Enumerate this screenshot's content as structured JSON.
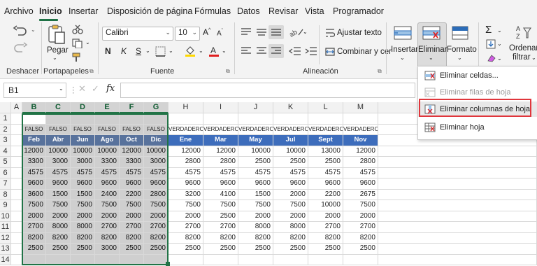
{
  "menu": {
    "tabs": [
      {
        "label": "Archivo"
      },
      {
        "label": "Inicio"
      },
      {
        "label": "Insertar"
      },
      {
        "label": "Disposición de página"
      },
      {
        "label": "Fórmulas"
      },
      {
        "label": "Datos"
      },
      {
        "label": "Revisar"
      },
      {
        "label": "Vista"
      },
      {
        "label": "Programador"
      }
    ]
  },
  "ribbon": {
    "undo_group_label": "Deshacer",
    "clipboard": {
      "paste_label": "Pegar",
      "group_label": "Portapapeles"
    },
    "font": {
      "name": "Calibri",
      "size": "10",
      "group_label": "Fuente",
      "bold": "N",
      "italic": "K",
      "underline": "S"
    },
    "alignment": {
      "wrap_label": "Ajustar texto",
      "merge_label": "Combinar y cer",
      "group_label": "Alineación"
    },
    "cells": {
      "insert_label": "Insertar",
      "delete_label": "Eliminar",
      "format_label": "Formato"
    },
    "editing": {
      "sort_label_1": "Ordenar y",
      "sort_label_2": "filtrar"
    }
  },
  "formula_bar": {
    "name_box": "B1",
    "fx": "fx",
    "value": ""
  },
  "delete_menu": {
    "items": [
      {
        "label": "Eliminar celdas...",
        "enabled": true
      },
      {
        "label": "Eliminar filas de hoja",
        "enabled": false
      },
      {
        "label": "Eliminar columnas de hoja",
        "enabled": true,
        "highlighted": true
      },
      {
        "label": "Eliminar hoja",
        "enabled": true
      }
    ]
  },
  "sheet": {
    "columns": [
      "A",
      "B",
      "C",
      "D",
      "E",
      "F",
      "G",
      "H",
      "I",
      "J",
      "K",
      "L",
      "M"
    ],
    "selected_columns": [
      "B",
      "C",
      "D",
      "E",
      "F",
      "G"
    ],
    "row_numbers": [
      "1",
      "2",
      "3",
      "4",
      "5",
      "6",
      "7",
      "8",
      "9",
      "10",
      "11",
      "12",
      "13",
      "14"
    ],
    "row2": [
      "FALSO",
      "FALSO",
      "FALSO",
      "FALSO",
      "FALSO",
      "FALSO",
      "VERDADERO",
      "VERDADERO",
      "VERDADERO",
      "VERDADERO",
      "VERDADERO",
      "VERDADERO"
    ],
    "row3": [
      "Feb",
      "Abr",
      "Jun",
      "Ago",
      "Oct",
      "Dic",
      "Ene",
      "Mar",
      "May",
      "Jul",
      "Sept",
      "Nov"
    ],
    "data": [
      [
        "12000",
        "10000",
        "10000",
        "10000",
        "12000",
        "10000",
        "12000",
        "12000",
        "10000",
        "10000",
        "13000",
        "12000"
      ],
      [
        "3300",
        "3000",
        "3000",
        "3300",
        "3300",
        "3000",
        "2800",
        "2800",
        "2500",
        "2500",
        "2500",
        "2800"
      ],
      [
        "4575",
        "4575",
        "4575",
        "4575",
        "4575",
        "4575",
        "4575",
        "4575",
        "4575",
        "4575",
        "4575",
        "4575"
      ],
      [
        "9600",
        "9600",
        "9600",
        "9600",
        "9600",
        "9600",
        "9600",
        "9600",
        "9600",
        "9600",
        "9600",
        "9600"
      ],
      [
        "3600",
        "1500",
        "1500",
        "2400",
        "2200",
        "2800",
        "3200",
        "4100",
        "1500",
        "2000",
        "2200",
        "2675"
      ],
      [
        "7500",
        "7500",
        "7500",
        "7500",
        "7500",
        "7500",
        "7500",
        "7500",
        "7500",
        "7500",
        "10000",
        "7500"
      ],
      [
        "2000",
        "2000",
        "2000",
        "2000",
        "2000",
        "2000",
        "2000",
        "2500",
        "2000",
        "2000",
        "2000",
        "2000"
      ],
      [
        "2700",
        "8000",
        "8000",
        "2700",
        "2700",
        "2700",
        "2700",
        "2700",
        "8000",
        "8000",
        "2700",
        "2700"
      ],
      [
        "8200",
        "8200",
        "8200",
        "8200",
        "8200",
        "8200",
        "8200",
        "8200",
        "8200",
        "8200",
        "8200",
        "8200"
      ],
      [
        "2500",
        "2500",
        "2500",
        "3000",
        "2500",
        "2500",
        "2500",
        "2500",
        "2500",
        "2500",
        "2500",
        "2500"
      ]
    ]
  }
}
